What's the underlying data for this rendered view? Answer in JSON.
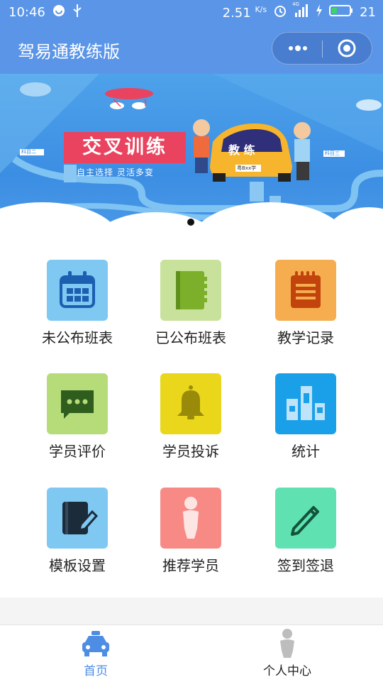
{
  "status_bar": {
    "time": "10:46",
    "speed": "2.51",
    "speed_unit": "K/s",
    "network": "4G",
    "battery": "21"
  },
  "nav": {
    "title": "驾易通教练版"
  },
  "banner": {
    "title": "交叉训练",
    "subtitle": "自主选择  灵活多变",
    "car_text": "教  练",
    "plate": "粤Bxx学",
    "sign_left": "科目二",
    "sign_right": "科目三"
  },
  "grid": {
    "items": [
      {
        "label": "未公布班表",
        "icon": "calendar-icon",
        "color": "#7ec8f2"
      },
      {
        "label": "已公布班表",
        "icon": "book-icon",
        "color": "#c8e29b"
      },
      {
        "label": "教学记录",
        "icon": "notepad-icon",
        "color": "#f6ad4f"
      },
      {
        "label": "学员评价",
        "icon": "chat-icon",
        "color": "#b5dc78"
      },
      {
        "label": "学员投诉",
        "icon": "bell-icon",
        "color": "#ead71b"
      },
      {
        "label": "统计",
        "icon": "bar-chart-icon",
        "color": "#1aa0e9"
      },
      {
        "label": "模板设置",
        "icon": "edit-note-icon",
        "color": "#7ec8f2"
      },
      {
        "label": "推荐学员",
        "icon": "person-icon",
        "color": "#f88a86"
      },
      {
        "label": "签到签退",
        "icon": "pencil-icon",
        "color": "#5fe1b1"
      }
    ]
  },
  "tabbar": {
    "tabs": [
      {
        "label": "首页",
        "icon": "car-icon",
        "active": true,
        "color": "#4d8de3"
      },
      {
        "label": "个人中心",
        "icon": "person-icon",
        "active": false,
        "color": "#222222"
      }
    ]
  }
}
